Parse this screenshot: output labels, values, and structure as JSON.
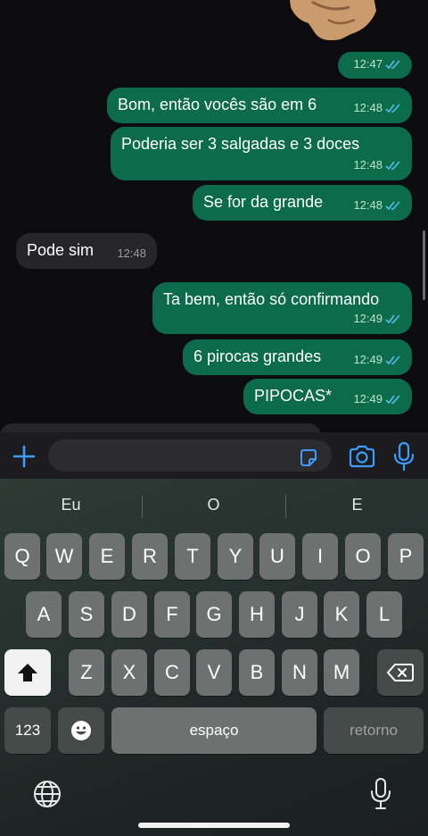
{
  "messages": [
    {
      "type": "out",
      "text": "",
      "time": "12:47"
    },
    {
      "type": "out",
      "text": "Bom, então vocês são em 6",
      "time": "12:48"
    },
    {
      "type": "out",
      "text": "Poderia ser 3 salgadas e 3 doces",
      "time": "12:48"
    },
    {
      "type": "out",
      "text": "Se for da grande",
      "time": "12:48"
    },
    {
      "type": "in",
      "text": "Pode sim",
      "time": "12:48"
    },
    {
      "type": "out",
      "text": "Ta bem, então só confirmando",
      "time": "12:49"
    },
    {
      "type": "out",
      "text": "6 pirocas grandes",
      "time": "12:49"
    },
    {
      "type": "out",
      "text": "PIPOCAS*",
      "time": "12:49"
    }
  ],
  "input": {
    "placeholder": ""
  },
  "keyboard": {
    "suggestions": [
      "Eu",
      "O",
      "E"
    ],
    "row1": [
      "Q",
      "W",
      "E",
      "R",
      "T",
      "Y",
      "U",
      "I",
      "O",
      "P"
    ],
    "row2": [
      "A",
      "S",
      "D",
      "F",
      "G",
      "H",
      "J",
      "K",
      "L"
    ],
    "row3": [
      "Z",
      "X",
      "C",
      "V",
      "B",
      "N",
      "M"
    ],
    "numbers_label": "123",
    "space_label": "espaço",
    "return_label": "retorno"
  },
  "colors": {
    "outgoing_bubble": "#0b6b4b",
    "incoming_bubble": "#262628",
    "accent_blue": "#3b9bff",
    "read_ticks": "#53bdeb"
  },
  "icons": [
    "plus-icon",
    "sticker-icon",
    "camera-icon",
    "microphone-icon",
    "shift-icon",
    "backspace-icon",
    "emoji-icon",
    "globe-icon",
    "dictation-icon"
  ]
}
